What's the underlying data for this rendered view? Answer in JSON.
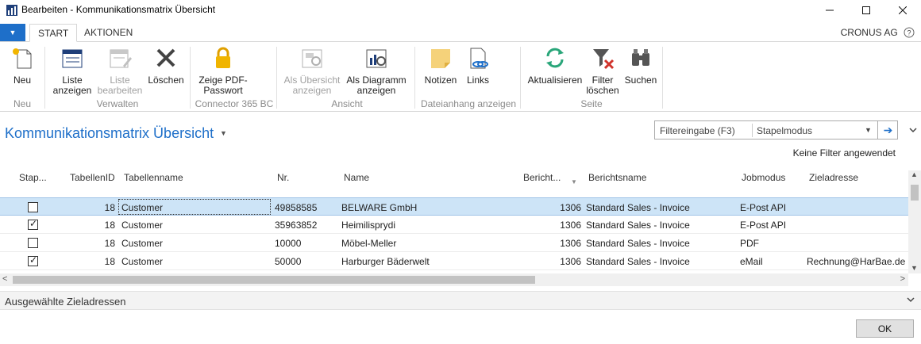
{
  "window": {
    "title": "Bearbeiten - Kommunikationsmatrix Übersicht",
    "minimize_icon": "minimize-icon",
    "maximize_icon": "maximize-icon",
    "close_icon": "close-icon"
  },
  "ribbon_tabs": {
    "file_icon": "dropdown-arrow-icon",
    "tabs": [
      {
        "label": "START",
        "active": true
      },
      {
        "label": "AKTIONEN",
        "active": false
      }
    ],
    "company": "CRONUS AG",
    "help_icon": "question-icon"
  },
  "ribbon": {
    "buttons": [
      {
        "label": "Neu",
        "icon": "new-document-icon",
        "enabled": true
      },
      {
        "label": "Liste anzeigen",
        "icon": "view-list-icon",
        "enabled": true
      },
      {
        "label": "Liste bearbeiten",
        "icon": "edit-list-icon",
        "enabled": false
      },
      {
        "label": "Löschen",
        "icon": "delete-x-icon",
        "enabled": true
      },
      {
        "label": "Zeige PDF-Passwort",
        "icon": "lock-icon",
        "enabled": true
      },
      {
        "label": "Als Übersicht anzeigen",
        "icon": "overview-icon",
        "enabled": false
      },
      {
        "label": "Als Diagramm anzeigen",
        "icon": "chart-icon",
        "enabled": true
      },
      {
        "label": "Notizen",
        "icon": "note-icon",
        "enabled": true
      },
      {
        "label": "Links",
        "icon": "link-icon",
        "enabled": true
      },
      {
        "label": "Aktualisieren",
        "icon": "refresh-icon",
        "enabled": true
      },
      {
        "label": "Filter löschen",
        "icon": "clear-filter-icon",
        "enabled": true
      },
      {
        "label": "Suchen",
        "icon": "binoculars-icon",
        "enabled": true
      }
    ],
    "groups": [
      "Neu",
      "Verwalten",
      "Connector 365 BC",
      "Ansicht",
      "Dateianhang anzeigen",
      "Seite"
    ]
  },
  "page": {
    "title": "Kommunikationsmatrix Übersicht",
    "filter_placeholder": "Filtereingabe (F3)",
    "filter_field": "Stapelmodus",
    "no_filter": "Keine Filter angewendet"
  },
  "table": {
    "columns": [
      "Stap...",
      "TabellenID",
      "Tabellenname",
      "Nr.",
      "Name",
      "Bericht...",
      "Berichtsname",
      "Jobmodus",
      "Zieladresse"
    ],
    "rows": [
      {
        "batch": false,
        "table_id": "18",
        "table_name": "Customer",
        "no": "49858585",
        "name": "BELWARE GmbH",
        "report_id": "1306",
        "report_name": "Standard Sales - Invoice",
        "job_mode": "E-Post API",
        "target": ""
      },
      {
        "batch": true,
        "table_id": "18",
        "table_name": "Customer",
        "no": "35963852",
        "name": "Heimilisprydi",
        "report_id": "1306",
        "report_name": "Standard Sales - Invoice",
        "job_mode": "E-Post API",
        "target": ""
      },
      {
        "batch": false,
        "table_id": "18",
        "table_name": "Customer",
        "no": "10000",
        "name": "Möbel-Meller",
        "report_id": "1306",
        "report_name": "Standard Sales - Invoice",
        "job_mode": "PDF",
        "target": ""
      },
      {
        "batch": true,
        "table_id": "18",
        "table_name": "Customer",
        "no": "50000",
        "name": "Harburger Bäderwelt",
        "report_id": "1306",
        "report_name": "Standard Sales - Invoice",
        "job_mode": "eMail",
        "target": "Rechnung@HarBae.de"
      }
    ]
  },
  "factbox": {
    "title": "Ausgewählte Zieladressen"
  },
  "footer": {
    "ok_label": "OK"
  },
  "colors": {
    "accent": "#1e6fc9",
    "selection": "#cde4f7"
  }
}
